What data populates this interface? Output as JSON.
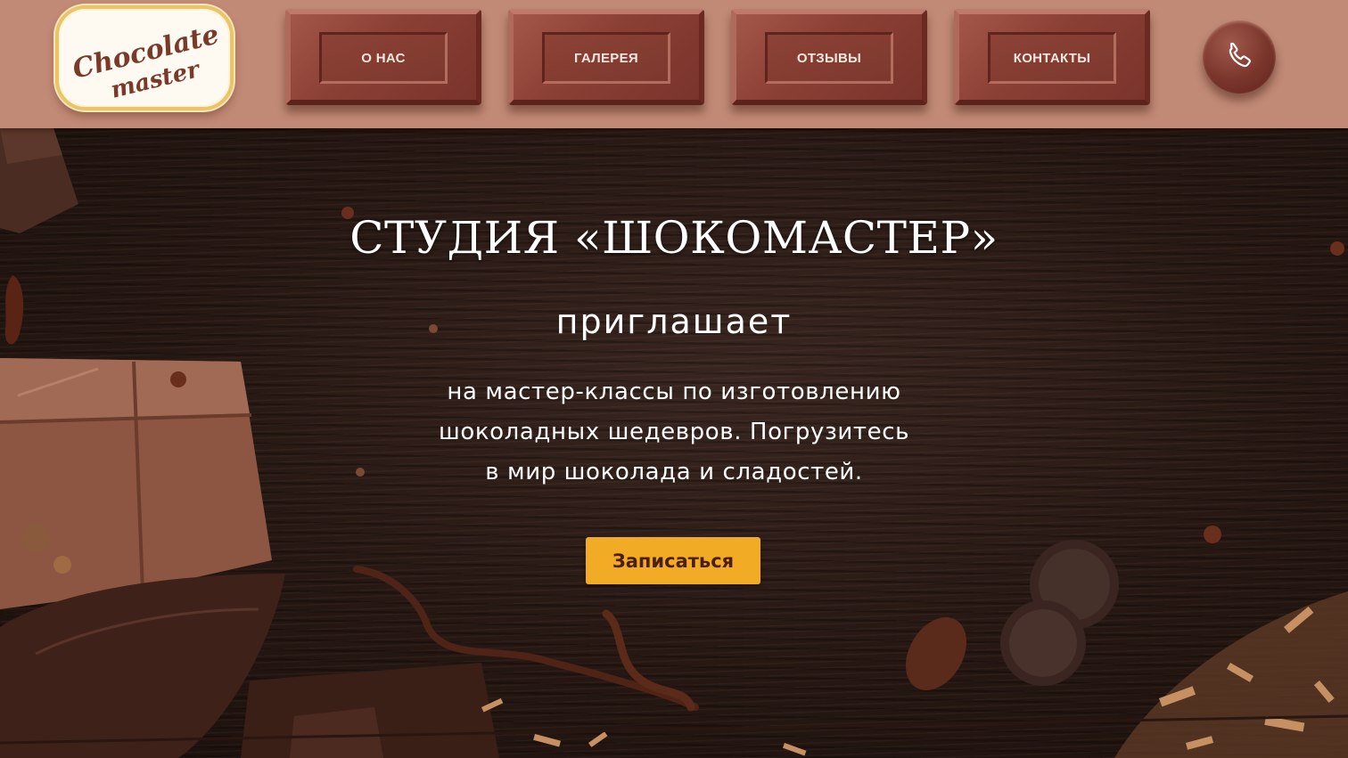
{
  "header": {
    "logo": {
      "line1": "Chocolate",
      "line2": "master"
    },
    "nav": [
      {
        "label": "О НАС"
      },
      {
        "label": "ГАЛЕРЕЯ"
      },
      {
        "label": "ОТЗЫВЫ"
      },
      {
        "label": "КОНТАКТЫ"
      }
    ],
    "phone_icon": "phone-icon"
  },
  "hero": {
    "title": "СТУДИЯ «ШОКОМАСТЕР»",
    "subtitle": "приглашает",
    "text_lines": [
      "на мастер-классы по изготовлению",
      "шоколадных шедевров. Погрузитесь",
      "в мир шоколада и сладостей."
    ],
    "cta_label": "Записаться"
  },
  "colors": {
    "header_bg": "#c08a76",
    "nav_button": "#8a3f34",
    "cta": "#f2ab24",
    "hero_bg": "#261712",
    "logo_border": "#e8c46a"
  }
}
